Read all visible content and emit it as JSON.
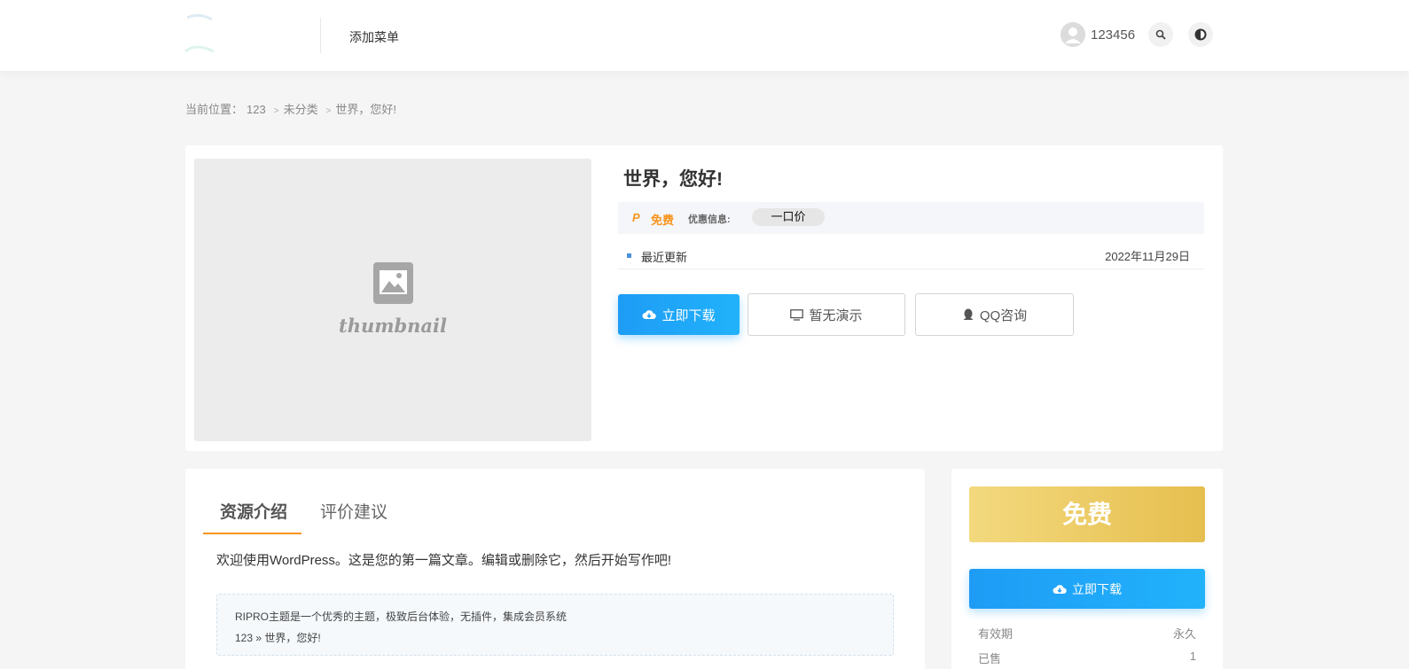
{
  "header": {
    "nav_item": "添加菜单",
    "username": "123456"
  },
  "breadcrumb": {
    "prefix": "当前位置：",
    "items": [
      "123",
      "未分类",
      "世界，您好!"
    ],
    "separator": ">"
  },
  "product": {
    "thumbnail_text": "thumbnail",
    "title": "世界，您好!",
    "price_label": "免费",
    "discount_label": "优惠信息:",
    "discount_value": "一口价",
    "info_key": "最近更新",
    "info_value": "2022年11月29日",
    "buttons": {
      "download": "立即下载",
      "demo": "暂无演示",
      "qq": "QQ咨询"
    }
  },
  "content": {
    "tabs": [
      "资源介绍",
      "评价建议"
    ],
    "intro": "欢迎使用WordPress。这是您的第一篇文章。编辑或删除它，然后开始写作吧!",
    "notice_line1": "RIPRO主题是一个优秀的主题，极致后台体验，无插件，集成会员系统",
    "notice_line2": "123 » 世界，您好!"
  },
  "sidebar": {
    "price": "免费",
    "download": "立即下载",
    "rows": [
      {
        "key": "有效期",
        "value": "永久"
      },
      {
        "key": "已售",
        "value": "1"
      }
    ]
  },
  "colors": {
    "accent_blue": "#1e9cf5",
    "accent_orange": "#f7941d",
    "gold": "#e6bf4f"
  },
  "icons": [
    "user-avatar-icon",
    "search-icon",
    "theme-toggle-icon",
    "image-placeholder-icon",
    "pay-icon",
    "cloud-download-icon",
    "monitor-icon",
    "qq-icon"
  ]
}
